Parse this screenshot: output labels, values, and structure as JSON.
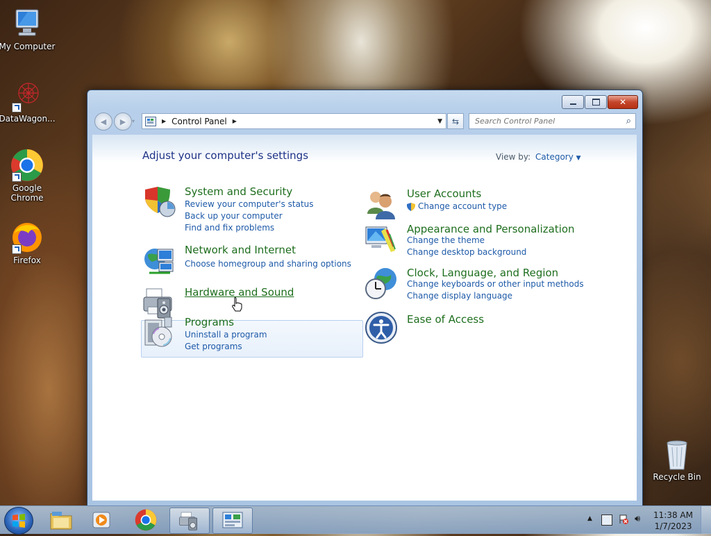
{
  "desktop": {
    "icons": [
      {
        "label": "My Computer",
        "icon": "computer-icon"
      },
      {
        "label": "DataWagon...",
        "icon": "datawagon-icon"
      },
      {
        "label": "Google Chrome",
        "icon": "chrome-icon"
      },
      {
        "label": "Firefox",
        "icon": "firefox-icon"
      },
      {
        "label": "Recycle Bin",
        "icon": "recycle-bin-icon"
      }
    ]
  },
  "window": {
    "address": {
      "root_icon": "control-panel-icon",
      "crumb": "Control Panel"
    },
    "search": {
      "placeholder": "Search Control Panel"
    },
    "heading": "Adjust your computer's settings",
    "view_by": {
      "label": "View by:",
      "value": "Category"
    },
    "categories_left": [
      {
        "title": "System and Security",
        "icon": "shield-icon",
        "links": [
          "Review your computer's status",
          "Back up your computer",
          "Find and fix problems"
        ]
      },
      {
        "title": "Network and Internet",
        "icon": "network-icon",
        "links": [
          "Choose homegroup and sharing options"
        ]
      },
      {
        "title": "Hardware and Sound",
        "icon": "printer-icon",
        "links": []
      },
      {
        "title": "Programs",
        "icon": "programs-icon",
        "links": [
          "Uninstall a program",
          "Get programs"
        ]
      }
    ],
    "categories_right": [
      {
        "title": "User Accounts",
        "icon": "users-icon",
        "links": [
          "Change account type"
        ]
      },
      {
        "title": "Appearance and Personalization",
        "icon": "appearance-icon",
        "links": [
          "Change the theme",
          "Change desktop background"
        ]
      },
      {
        "title": "Clock, Language, and Region",
        "icon": "clock-globe-icon",
        "links": [
          "Change keyboards or other input methods",
          "Change display language"
        ]
      },
      {
        "title": "Ease of Access",
        "icon": "ease-of-access-icon",
        "links": []
      }
    ]
  },
  "taskbar": {
    "items": [
      "explorer-icon",
      "media-player-icon",
      "chrome-icon",
      "devices-icon",
      "control-panel-icon"
    ],
    "clock": {
      "time": "11:38 AM",
      "date": "1/7/2023"
    }
  }
}
